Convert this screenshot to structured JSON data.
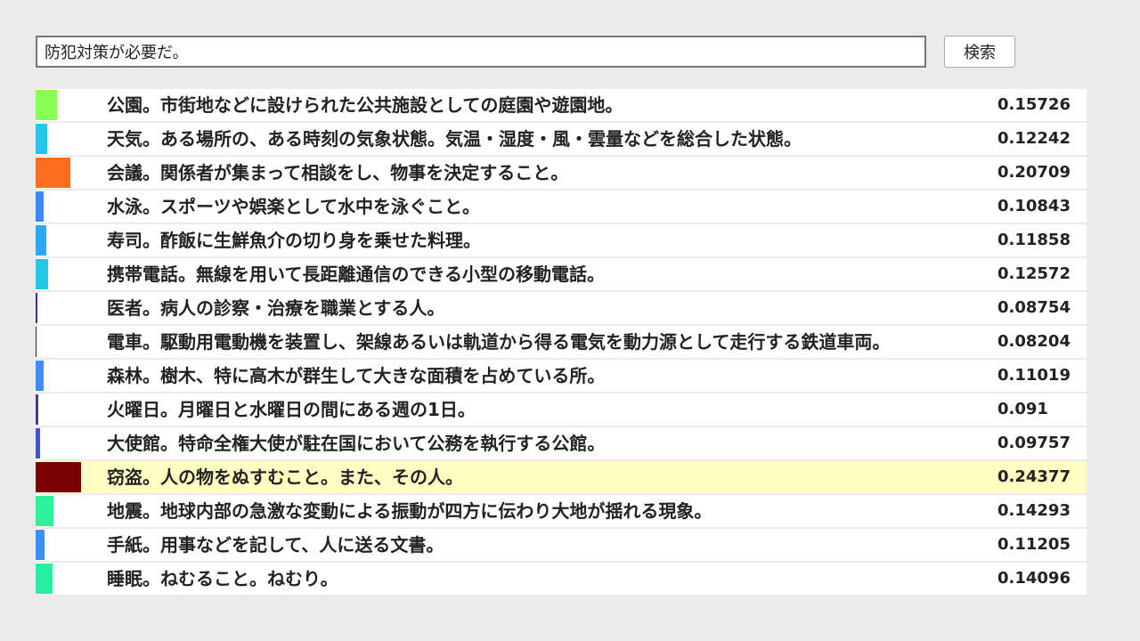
{
  "search": {
    "value": "防犯対策が必要だ。",
    "button_label": "検索"
  },
  "results": [
    {
      "text": "公園。市街地などに設けられた公共施設としての庭園や遊園地。",
      "score": "0.15726",
      "color": "#88ff55",
      "highlighted": false
    },
    {
      "text": "天気。ある場所の、ある時刻の気象状態。気温・湿度・風・雲量などを総合した状態。",
      "score": "0.12242",
      "color": "#27c4ee",
      "highlighted": false
    },
    {
      "text": "会議。関係者が集まって相談をし、物事を決定すること。",
      "score": "0.20709",
      "color": "#fb6e1d",
      "highlighted": false
    },
    {
      "text": "水泳。スポーツや娯楽として水中を泳ぐこと。",
      "score": "0.10843",
      "color": "#3d88f7",
      "highlighted": false
    },
    {
      "text": "寿司。酢飯に生鮮魚介の切り身を乗せた料理。",
      "score": "0.11858",
      "color": "#2aa9f7",
      "highlighted": false
    },
    {
      "text": "携帯電話。無線を用いて長距離通信のできる小型の移動電話。",
      "score": "0.12572",
      "color": "#22c8e6",
      "highlighted": false
    },
    {
      "text": "医者。病人の診察・治療を職業とする人。",
      "score": "0.08754",
      "color": "#4a2a82",
      "highlighted": false
    },
    {
      "text": "電車。駆動用電動機を装置し、架線あるいは軌道から得る電気を動力源として走行する鉄道車両。",
      "score": "0.08204",
      "color": "#30123b",
      "highlighted": false
    },
    {
      "text": "森林。樹木、特に高木が群生して大きな面積を占めている所。",
      "score": "0.11019",
      "color": "#3f8df7",
      "highlighted": false
    },
    {
      "text": "火曜日。月曜日と水曜日の間にある週の1日。",
      "score": "0.091",
      "color": "#4a3a92",
      "highlighted": false
    },
    {
      "text": "大使館。特命全権大使が駐在国において公務を執行する公館。",
      "score": "0.09757",
      "color": "#4654c8",
      "highlighted": false
    },
    {
      "text": "窃盗。人の物をぬすむこと。また、その人。",
      "score": "0.24377",
      "color": "#7a0403",
      "highlighted": true
    },
    {
      "text": "地震。地球内部の急激な変動による振動が四方に伝わり大地が揺れる現象。",
      "score": "0.14293",
      "color": "#2ef19a",
      "highlighted": false
    },
    {
      "text": "手紙。用事などを記して、人に送る文書。",
      "score": "0.11205",
      "color": "#3c8ff7",
      "highlighted": false
    },
    {
      "text": "睡眠。ねむること。ねむり。",
      "score": "0.14096",
      "color": "#2aee9f",
      "highlighted": false
    }
  ]
}
